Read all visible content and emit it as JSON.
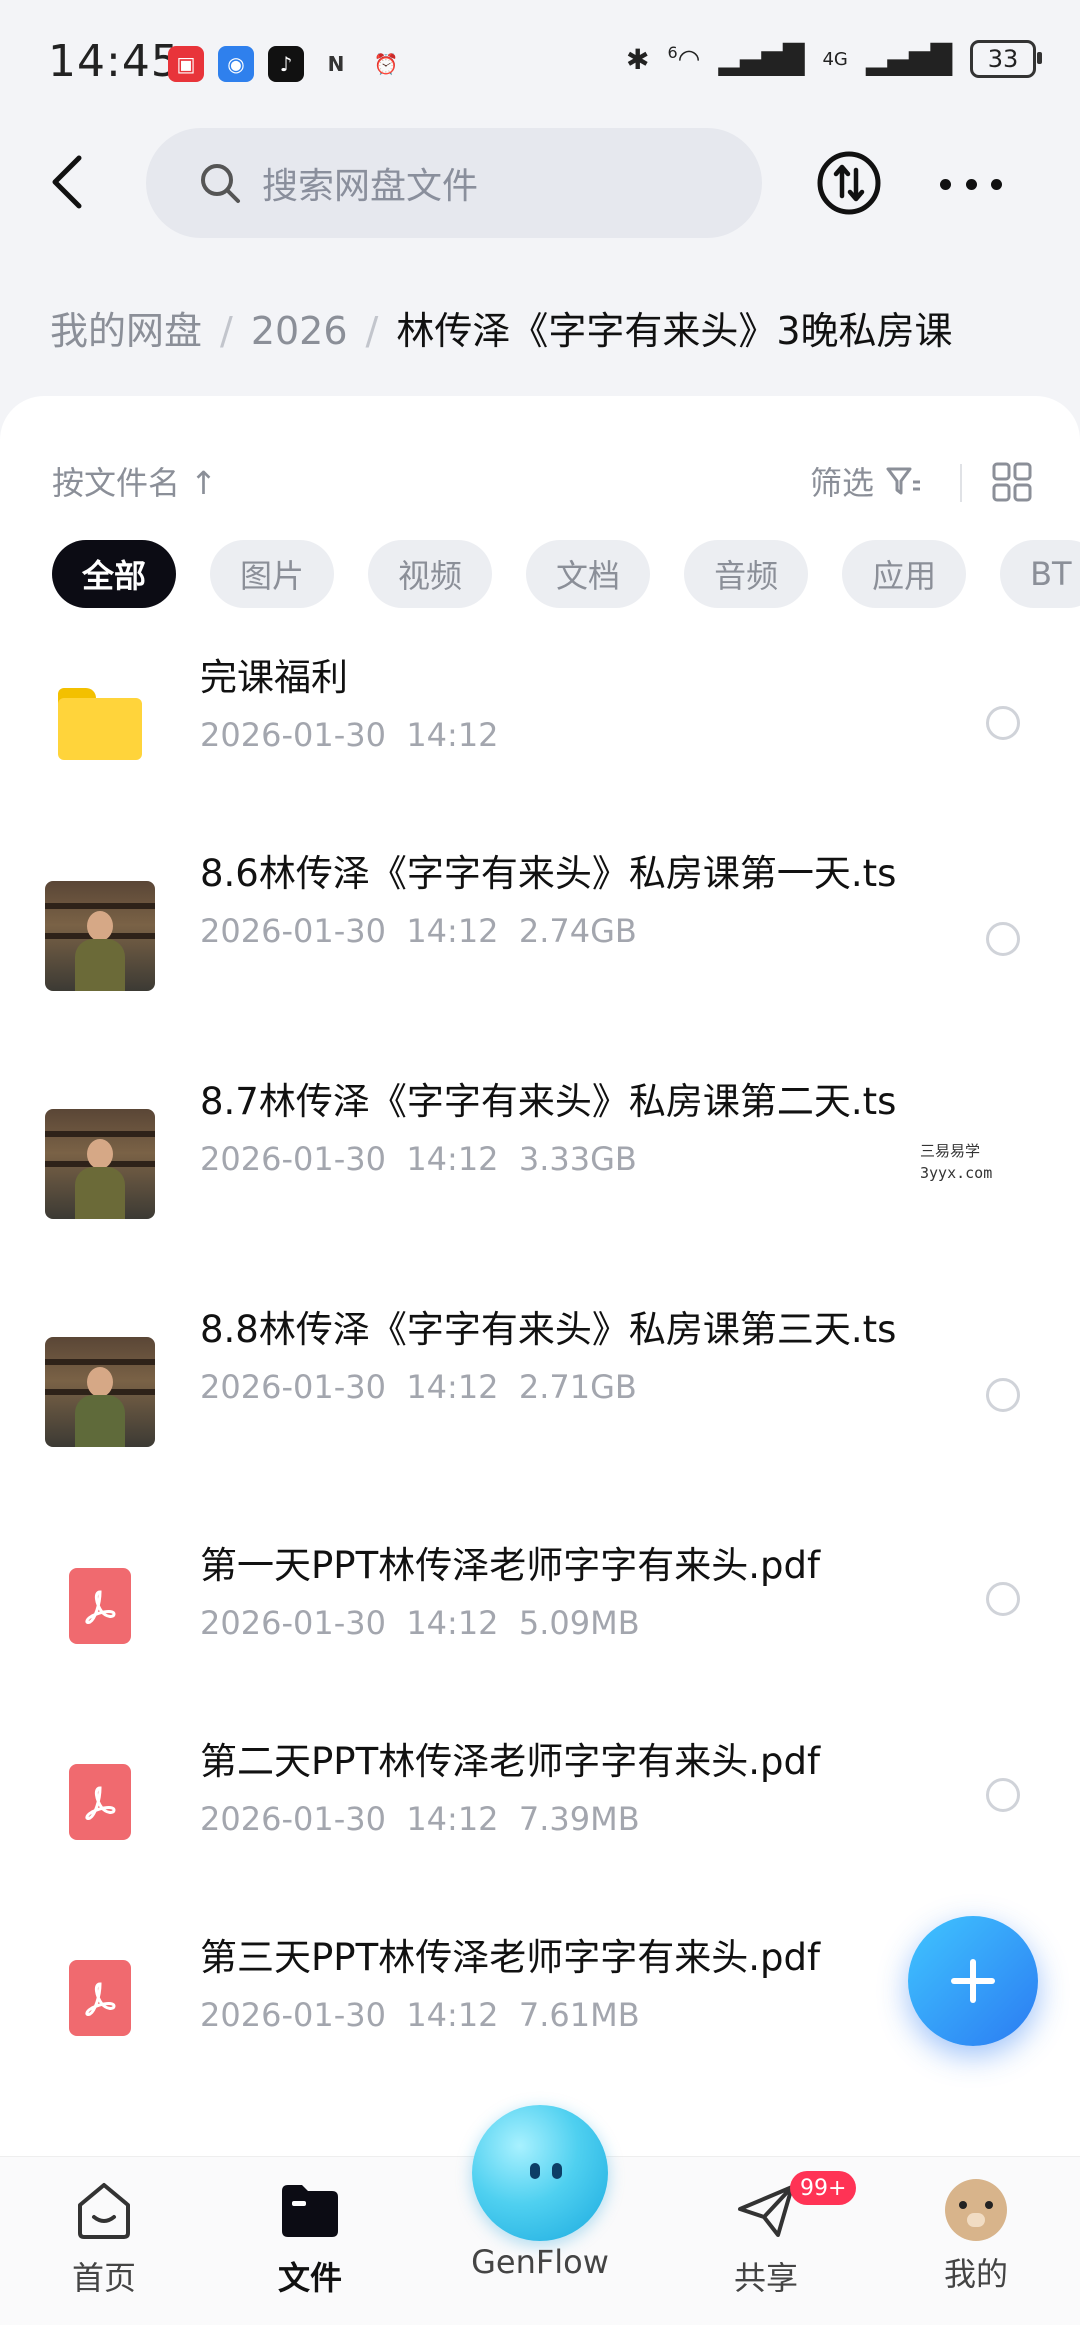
{
  "status_bar": {
    "time": "14:45",
    "battery": "33",
    "network_label": "4G",
    "wifi_superscript": "6"
  },
  "search": {
    "placeholder": "搜索网盘文件"
  },
  "breadcrumb": {
    "items": [
      "我的网盘",
      "2026"
    ],
    "current": "林传泽《字字有来头》3晚私房课"
  },
  "sort": {
    "label": "按文件名 ↑",
    "filter_label": "筛选"
  },
  "chips": [
    "全部",
    "图片",
    "视频",
    "文档",
    "音频",
    "应用",
    "BT"
  ],
  "files": [
    {
      "name": "完课福利",
      "date": "2026-01-30",
      "time": "14:12",
      "size": "",
      "type": "folder-icon"
    },
    {
      "name": "8.6林传泽《字字有来头》私房课第一天.ts",
      "date": "2026-01-30",
      "time": "14:12",
      "size": "2.74GB",
      "type": "video-thumbnail"
    },
    {
      "name": "8.7林传泽《字字有来头》私房课第二天.ts",
      "date": "2026-01-30",
      "time": "14:12",
      "size": "3.33GB",
      "type": "video-thumbnail"
    },
    {
      "name": "8.8林传泽《字字有来头》私房课第三天.ts",
      "date": "2026-01-30",
      "time": "14:12",
      "size": "2.71GB",
      "type": "video-thumbnail"
    },
    {
      "name": "第一天PPT林传泽老师字字有来头.pdf",
      "date": "2026-01-30",
      "time": "14:12",
      "size": "5.09MB",
      "type": "pdf-icon"
    },
    {
      "name": "第二天PPT林传泽老师字字有来头.pdf",
      "date": "2026-01-30",
      "time": "14:12",
      "size": "7.39MB",
      "type": "pdf-icon"
    },
    {
      "name": "第三天PPT林传泽老师字字有来头.pdf",
      "date": "2026-01-30",
      "time": "14:12",
      "size": "7.61MB",
      "type": "pdf-icon"
    }
  ],
  "watermark": {
    "line1": "三易易学",
    "line2": "3yyx.com"
  },
  "nav": [
    {
      "label": "首页",
      "icon": "home-icon"
    },
    {
      "label": "文件",
      "icon": "folder-icon"
    },
    {
      "label": "GenFlow",
      "icon": "genflow-icon"
    },
    {
      "label": "共享",
      "icon": "paper-plane-icon",
      "badge": "99+"
    },
    {
      "label": "我的",
      "icon": "avatar"
    }
  ],
  "colors": {
    "accent": "#2b7bf2",
    "pdf": "#f06a6f",
    "folder": "#ffd43b",
    "badge": "#ff3355"
  }
}
